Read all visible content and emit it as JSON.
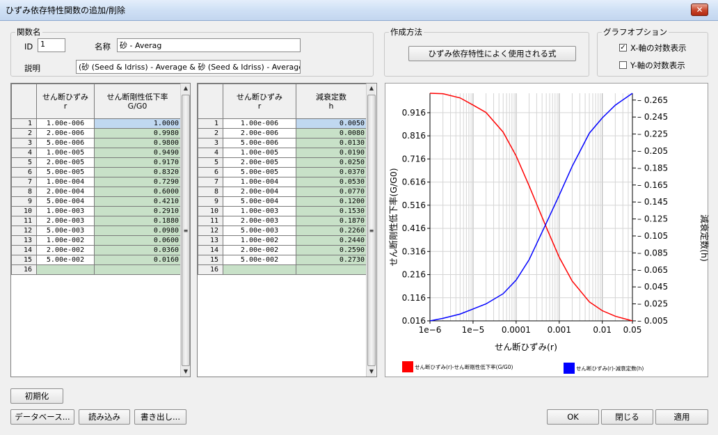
{
  "window": {
    "title": "ひずみ依存特性関数の追加/削除",
    "close_glyph": "✕"
  },
  "function_group": {
    "legend": "関数名",
    "id_label": "ID",
    "id_value": "1",
    "name_label": "名称",
    "name_value": "砂 - Averag",
    "desc_label": "説明",
    "desc_value": "(砂 (Seed & Idriss) - Average & 砂 (Seed & Idriss) - Average)"
  },
  "method_group": {
    "legend": "作成方法",
    "button_label": "ひずみ依存特性によく使用される式"
  },
  "graph_options": {
    "legend": "グラフオプション",
    "x_log_label": "X-軸の対数表示",
    "x_log_checked": true,
    "y_log_label": "Y-軸の対数表示",
    "y_log_checked": false
  },
  "table1": {
    "headers": [
      [
        "",
        ""
      ],
      [
        "せん断ひずみ",
        "r"
      ],
      [
        "せん断剛性低下率",
        "G/G0"
      ]
    ],
    "rows": [
      [
        "1",
        "1.00e-006",
        "1.0000"
      ],
      [
        "2",
        "2.00e-006",
        "0.9980"
      ],
      [
        "3",
        "5.00e-006",
        "0.9800"
      ],
      [
        "4",
        "1.00e-005",
        "0.9490"
      ],
      [
        "5",
        "2.00e-005",
        "0.9170"
      ],
      [
        "6",
        "5.00e-005",
        "0.8320"
      ],
      [
        "7",
        "1.00e-004",
        "0.7290"
      ],
      [
        "8",
        "2.00e-004",
        "0.6000"
      ],
      [
        "9",
        "5.00e-004",
        "0.4210"
      ],
      [
        "10",
        "1.00e-003",
        "0.2910"
      ],
      [
        "11",
        "2.00e-003",
        "0.1880"
      ],
      [
        "12",
        "5.00e-003",
        "0.0980"
      ],
      [
        "13",
        "1.00e-002",
        "0.0600"
      ],
      [
        "14",
        "2.00e-002",
        "0.0360"
      ],
      [
        "15",
        "5.00e-002",
        "0.0160"
      ],
      [
        "16",
        "",
        ""
      ]
    ]
  },
  "table2": {
    "headers": [
      [
        "",
        ""
      ],
      [
        "せん断ひずみ",
        "r"
      ],
      [
        "減衰定数",
        "h"
      ]
    ],
    "rows": [
      [
        "1",
        "1.00e-006",
        "0.0050"
      ],
      [
        "2",
        "2.00e-006",
        "0.0080"
      ],
      [
        "3",
        "5.00e-006",
        "0.0130"
      ],
      [
        "4",
        "1.00e-005",
        "0.0190"
      ],
      [
        "5",
        "2.00e-005",
        "0.0250"
      ],
      [
        "6",
        "5.00e-005",
        "0.0370"
      ],
      [
        "7",
        "1.00e-004",
        "0.0530"
      ],
      [
        "8",
        "2.00e-004",
        "0.0770"
      ],
      [
        "9",
        "5.00e-004",
        "0.1200"
      ],
      [
        "10",
        "1.00e-003",
        "0.1530"
      ],
      [
        "11",
        "2.00e-003",
        "0.1870"
      ],
      [
        "12",
        "5.00e-003",
        "0.2260"
      ],
      [
        "13",
        "1.00e-002",
        "0.2440"
      ],
      [
        "14",
        "2.00e-002",
        "0.2590"
      ],
      [
        "15",
        "5.00e-002",
        "0.2730"
      ],
      [
        "16",
        "",
        ""
      ]
    ]
  },
  "chart_data": {
    "type": "line",
    "x": [
      1e-06,
      2e-06,
      5e-06,
      1e-05,
      2e-05,
      5e-05,
      0.0001,
      0.0002,
      0.0005,
      0.001,
      0.002,
      0.005,
      0.01,
      0.02,
      0.05
    ],
    "series": [
      {
        "name": "せん断ひずみ(r)-せん断剛性低下率(G/G0)",
        "axis": "left",
        "color": "#ff0000",
        "values": [
          1.0,
          0.998,
          0.98,
          0.949,
          0.917,
          0.832,
          0.729,
          0.6,
          0.421,
          0.291,
          0.188,
          0.098,
          0.06,
          0.036,
          0.016
        ]
      },
      {
        "name": "せん断ひずみ(r)-減衰定数(h)",
        "axis": "right",
        "color": "#0000ff",
        "values": [
          0.005,
          0.008,
          0.013,
          0.019,
          0.025,
          0.037,
          0.053,
          0.077,
          0.12,
          0.153,
          0.187,
          0.226,
          0.244,
          0.259,
          0.273
        ]
      }
    ],
    "xlabel": "せん断ひずみ(r)",
    "ylabel": "せん断剛性低下率(G/G0)",
    "y2label": "減衰定数(h)",
    "x_scale": "log",
    "xlim": [
      1e-06,
      0.05
    ],
    "xticks": [
      "1e−6",
      "1e−5",
      "0.0001",
      "0.001",
      "0.01",
      "0.05"
    ],
    "ylim": [
      0.016,
      1.0
    ],
    "yticks": [
      "0.016",
      "0.116",
      "0.216",
      "0.316",
      "0.416",
      "0.516",
      "0.616",
      "0.716",
      "0.816",
      "0.916"
    ],
    "y2lim": [
      0.005,
      0.273
    ],
    "y2ticks": [
      "0.005",
      "0.025",
      "0.045",
      "0.065",
      "0.085",
      "0.105",
      "0.125",
      "0.145",
      "0.165",
      "0.185",
      "0.205",
      "0.225",
      "0.245",
      "0.265"
    ],
    "grid": true,
    "legend_position": "bottom"
  },
  "bottom_buttons": {
    "init": "初期化",
    "database": "データベース...",
    "load": "読み込み",
    "export": "書き出し...",
    "ok": "OK",
    "close": "閉じる",
    "apply": "適用"
  }
}
